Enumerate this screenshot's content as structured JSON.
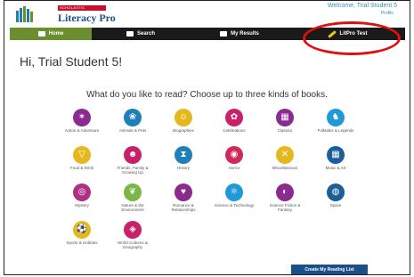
{
  "header": {
    "brand_tag": "Scholastic",
    "brand_name": "Literacy Pro",
    "welcome": "Welcome, Trial Student 5",
    "welcome_sub": "Profile"
  },
  "nav": {
    "tabs": [
      {
        "label": "Home",
        "icon": "home-icon",
        "active": true
      },
      {
        "label": "Search",
        "icon": "books-icon",
        "active": false
      },
      {
        "label": "My Results",
        "icon": "results-icon",
        "active": false
      },
      {
        "label": "LitPro Test",
        "icon": "pencil-icon",
        "active": false
      }
    ]
  },
  "greeting": "Hi, Trial Student 5!",
  "prompt": "What do you like to read? Choose up to three kinds of books.",
  "categories": [
    {
      "label": "Action & Adventure",
      "icon": "action-icon",
      "color": "#8b2a8f",
      "glyph": "✶"
    },
    {
      "label": "Animals & Pets",
      "icon": "paw-icon",
      "color": "#1f7fb8",
      "glyph": "❀"
    },
    {
      "label": "Biographies",
      "icon": "person-icon",
      "color": "#e6b820",
      "glyph": "☺"
    },
    {
      "label": "Celebrations",
      "icon": "celebration-icon",
      "color": "#c8206a",
      "glyph": "✿"
    },
    {
      "label": "Classics",
      "icon": "classics-icon",
      "color": "#8b2a8f",
      "glyph": "▦"
    },
    {
      "label": "Folktales & Legends",
      "icon": "dragon-icon",
      "color": "#1f9ad6",
      "glyph": "♞"
    },
    {
      "label": "Food & Drink",
      "icon": "pizza-icon",
      "color": "#e6b820",
      "glyph": "▽"
    },
    {
      "label": "Friends, Family & Growing Up",
      "icon": "family-icon",
      "color": "#c8206a",
      "glyph": "☻"
    },
    {
      "label": "History",
      "icon": "hourglass-icon",
      "color": "#1f7fb8",
      "glyph": "⧗"
    },
    {
      "label": "Horror",
      "icon": "horror-icon",
      "color": "#d0285a",
      "glyph": "◉"
    },
    {
      "label": "Miscellaneous",
      "icon": "shuffle-icon",
      "color": "#e6b820",
      "glyph": "✕"
    },
    {
      "label": "Music & Art",
      "icon": "music-art-icon",
      "color": "#1b5f9a",
      "glyph": "▦"
    },
    {
      "label": "Mystery",
      "icon": "magnifier-icon",
      "color": "#b03085",
      "glyph": "◎"
    },
    {
      "label": "Nature & the Environment",
      "icon": "nature-icon",
      "color": "#7ab648",
      "glyph": "❦"
    },
    {
      "label": "Romance & Relationships",
      "icon": "heart-icon",
      "color": "#8b2a8f",
      "glyph": "♥"
    },
    {
      "label": "Science & Technology",
      "icon": "science-icon",
      "color": "#1f9ad6",
      "glyph": "⚛"
    },
    {
      "label": "Science Fiction & Fantasy",
      "icon": "scifi-icon",
      "color": "#8b2a8f",
      "glyph": "◐"
    },
    {
      "label": "Space",
      "icon": "planet-icon",
      "color": "#1b5f9a",
      "glyph": "◍"
    },
    {
      "label": "Sports & Hobbies",
      "icon": "sports-icon",
      "color": "#e6b820",
      "glyph": "⚽"
    },
    {
      "label": "World Cultures & Geography",
      "icon": "globe-icon",
      "color": "#c8206a",
      "glyph": "◈"
    }
  ],
  "create_button": "Create My Reading List",
  "colors": {
    "nav_active": "#6a8f2c",
    "nav_bg": "#1a1a1a",
    "highlight": "#e01010",
    "button": "#1b4f8a"
  }
}
